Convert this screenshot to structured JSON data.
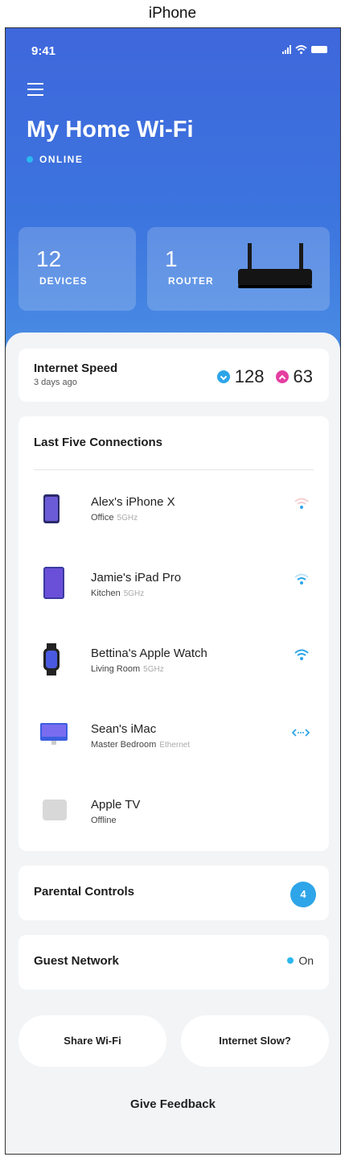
{
  "caption": "iPhone",
  "status": {
    "time": "9:41"
  },
  "header": {
    "title": "My Home Wi-Fi",
    "status": "ONLINE"
  },
  "tiles": [
    {
      "count": "12",
      "label": "DEVICES"
    },
    {
      "count": "1",
      "label": "ROUTER"
    }
  ],
  "speed": {
    "title": "Internet Speed",
    "subtitle": "3 days ago",
    "download": "128",
    "upload": "63"
  },
  "connections": {
    "title": "Last Five Connections",
    "items": [
      {
        "name": "Alex's iPhone X",
        "location": "Office",
        "band": "5GHz",
        "signal": "wifi-weak"
      },
      {
        "name": "Jamie's iPad Pro",
        "location": "Kitchen",
        "band": "5GHz",
        "signal": "wifi-medium"
      },
      {
        "name": "Bettina's Apple Watch",
        "location": "Living Room",
        "band": "5GHz",
        "signal": "wifi-strong"
      },
      {
        "name": "Sean's iMac",
        "location": "Master Bedroom",
        "band": "Ethernet",
        "signal": "ethernet"
      },
      {
        "name": "Apple TV",
        "location": "Offline",
        "band": "",
        "signal": "none"
      }
    ]
  },
  "parental": {
    "label": "Parental Controls",
    "count": "4"
  },
  "guest": {
    "label": "Guest Network",
    "status": "On"
  },
  "actions": {
    "share": "Share Wi-Fi",
    "slow": "Internet Slow?",
    "feedback": "Give Feedback"
  },
  "colors": {
    "accent": "#2ea5e8",
    "upload": "#e53ea1",
    "hero_top": "#3e67dc",
    "hero_bottom": "#4b8fe4"
  }
}
